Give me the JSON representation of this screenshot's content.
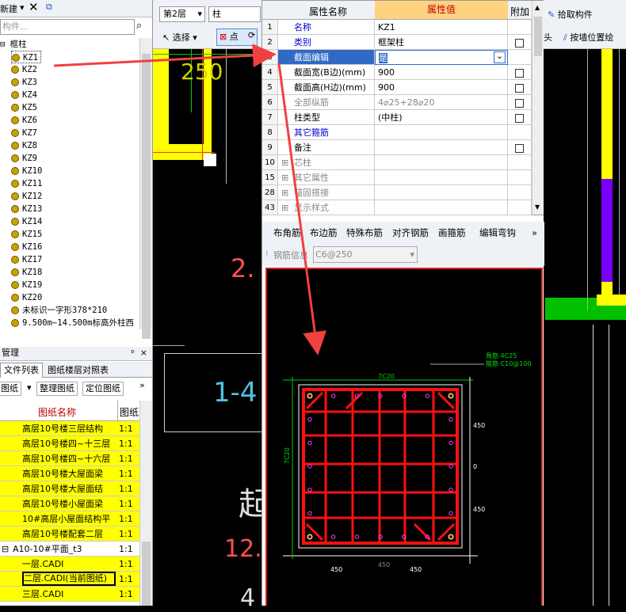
{
  "left_panel": {
    "new_label": "新建",
    "search_placeholder": "构件...",
    "tree_root": "框柱",
    "items": [
      "KZ1",
      "KZ2",
      "KZ3",
      "KZ4",
      "KZ5",
      "KZ6",
      "KZ7",
      "KZ8",
      "KZ9",
      "KZ10",
      "KZ11",
      "KZ12",
      "KZ13",
      "KZ14",
      "KZ15",
      "KZ16",
      "KZ17",
      "KZ18",
      "KZ19",
      "KZ20",
      "未标识一字形378*210",
      "9.500m~14.500m标高外柱西"
    ],
    "manage_title": "管理",
    "tabs": [
      "文件列表",
      "图纸楼层对照表"
    ],
    "buttons": [
      "加图纸",
      "整理图纸",
      "定位图纸"
    ],
    "col_name": "图纸名称",
    "col_scale": "图纸",
    "drawings": [
      {
        "name": "高层10号楼三层结构",
        "scale": "1:1"
      },
      {
        "name": "高层10号楼四~十三层",
        "scale": "1:1"
      },
      {
        "name": "高层10号楼四~十六层",
        "scale": "1:1"
      },
      {
        "name": "高层10号楼大屋面梁",
        "scale": "1:1"
      },
      {
        "name": "高层10号楼大屋面结",
        "scale": "1:1"
      },
      {
        "name": "高层10号楼小屋面梁",
        "scale": "1:1"
      },
      {
        "name": "10#高层小屋面结构平",
        "scale": "1:1"
      },
      {
        "name": "高层10号楼配套二层",
        "scale": "1:1"
      }
    ],
    "group": "A10-10#平面_t3",
    "group_scale": "1:1",
    "subfiles": [
      {
        "name": "一层.CADI",
        "scale": "1:1"
      },
      {
        "name": "二层.CADI(当前图纸)",
        "scale": "1:1"
      },
      {
        "name": "三层.CADI",
        "scale": "1:1"
      }
    ]
  },
  "toolbar": {
    "floor": "第2层",
    "type": "柱",
    "select": "选择",
    "point": "点",
    "pick": "拾取构件",
    "head": "头",
    "wall_pos": "按墙位置绘"
  },
  "props": {
    "header": {
      "name": "属性名称",
      "value": "属性值",
      "extra": "附加"
    },
    "rows": [
      {
        "num": "1",
        "name": "名称",
        "value": "KZ1",
        "check": false,
        "color": "#0000cc"
      },
      {
        "num": "2",
        "name": "类别",
        "value": "框架柱",
        "check": true,
        "color": "#0000cc"
      },
      {
        "num": "3",
        "name": "截面编辑",
        "value": "是",
        "check": false,
        "color": "#000"
      },
      {
        "num": "4",
        "name": "截面宽(B边)(mm)",
        "value": "900",
        "check": true,
        "color": "#000"
      },
      {
        "num": "5",
        "name": "截面高(H边)(mm)",
        "value": "900",
        "check": true,
        "color": "#000"
      },
      {
        "num": "6",
        "name": "全部纵筋",
        "value": "4⌀25+28⌀20",
        "check": true,
        "color": "#888"
      },
      {
        "num": "7",
        "name": "柱类型",
        "value": "(中柱)",
        "check": true,
        "color": "#000"
      },
      {
        "num": "8",
        "name": "其它箍筋",
        "value": "",
        "check": false,
        "color": "#0000cc"
      },
      {
        "num": "9",
        "name": "备注",
        "value": "",
        "check": true,
        "color": "#000"
      },
      {
        "num": "10",
        "name": "芯柱",
        "value": "",
        "check": false,
        "color": "#888"
      },
      {
        "num": "15",
        "name": "其它属性",
        "value": "",
        "check": false,
        "color": "#888"
      },
      {
        "num": "28",
        "name": "锚固搭接",
        "value": "",
        "check": false,
        "color": "#888"
      },
      {
        "num": "43",
        "name": "显示样式",
        "value": "",
        "check": false,
        "color": "#888"
      }
    ]
  },
  "rebar_toolbar": {
    "buttons": [
      "布角筋",
      "布边筋",
      "特殊布筋",
      "对齐钢筋",
      "画箍筋",
      "编辑弯钩"
    ],
    "info_label": "钢筋信息",
    "info_value": "C6@250"
  },
  "section": {
    "top_label": "7C20",
    "left_label": "7C20",
    "legend_corner": "角筋  4C25",
    "legend_stirrup": "箍筋  C10@100",
    "dims_bottom": [
      "450",
      "450"
    ],
    "dims_right": [
      "450",
      "0",
      "450"
    ],
    "dim_top_small": "450"
  },
  "canvas_labels": {
    "t250": "250",
    "t2": "2.",
    "t14": "1-4",
    "tqi": "起",
    "t12": "12.",
    "t4": "4"
  },
  "colors": {
    "yellow": "#ffff00",
    "red": "#ff0000",
    "green": "#00cc00",
    "purple": "#7a00ff",
    "highlight": "#316ac5"
  }
}
